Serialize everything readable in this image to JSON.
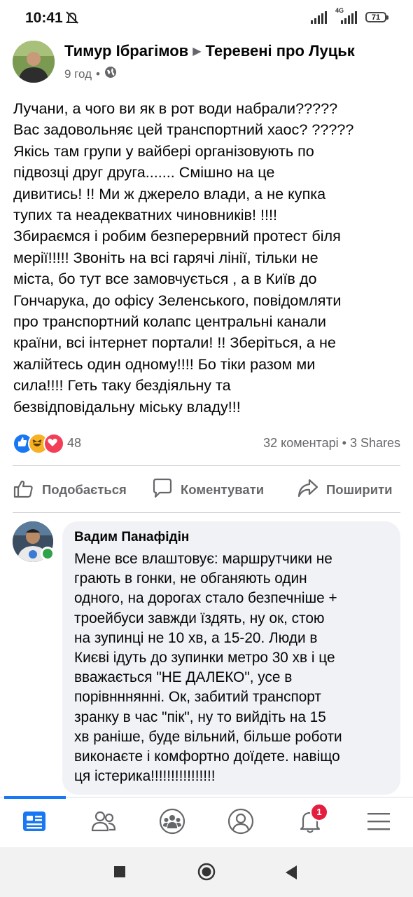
{
  "status_bar": {
    "time": "10:41",
    "network": "4G",
    "battery": "71"
  },
  "post": {
    "author": "Тимур Ібрагімов",
    "group": "Теревені про Луцьк",
    "time_ago": "9 год",
    "privacy_icon": "globe-icon",
    "text_lines": [
      "Лучани,  а чого ви як в рот води набрали?????",
      "Вас задовольняє цей транспортний  хаос? ?????",
      "Якісь там групи у вайбері  організовують по",
      "підвозці  друг друга....... Смішно на це",
      "дивитись! !! Ми ж джерело влади, а не купка",
      "тупих та неадекватних чиновників! !!!!",
      "Збираємся  і робим безперервний  протест біля",
      "мерії!!!!! Звоніть  на всі гарячі лінії, тільки не",
      "міста, бо тут все замовчується , а в Київ до",
      "Гончарука, до офісу Зеленського, повідомляти",
      "про транспортний колапс центральні канали",
      "країни, всі інтернет портали! !! Зберіться,  а не",
      "жалійтесь один одному!!!! Бо тіки разом  ми",
      "сила!!!! Геть таку  бездіяльну та",
      "безвідповідальну міську владу!!!"
    ],
    "reactions_count": "48",
    "comments_count": "32 коментарі",
    "separator": "•",
    "shares": "3 Shares",
    "reaction_colors": {
      "like": "#1877f2",
      "haha": "#f7b125",
      "love": "#f33e58"
    }
  },
  "actions": {
    "like": "Подобається",
    "comment": "Коментувати",
    "share": "Поширити"
  },
  "comment": {
    "author": "Вадим Панафідін",
    "text_lines": [
      "Мене все влаштовує: маршрутчики не",
      "грають в гонки, не обганяють один",
      "одного, на дорогах стало безпечніше +",
      "троейбуси завжди їздять, ну ок, стою",
      "на зупинці не 10 хв, а 15-20. Люди в",
      "Києві ідуть до зупинки метро 30 хв і це",
      "вважається \"НЕ ДАЛЕКО\", усе в",
      "порівнннянні.  Ок, забитий транспорт",
      "зранку в час \"пік\", ну то вийдіть на 15",
      "хв раніше, буде вільний, більше роботи",
      "виконаєте і комфортно доїдете. навіщо",
      "ця істерика!!!!!!!!!!!!!!!!"
    ]
  },
  "tabbar": {
    "notifications_badge": "1",
    "accent": "#1877f2"
  }
}
